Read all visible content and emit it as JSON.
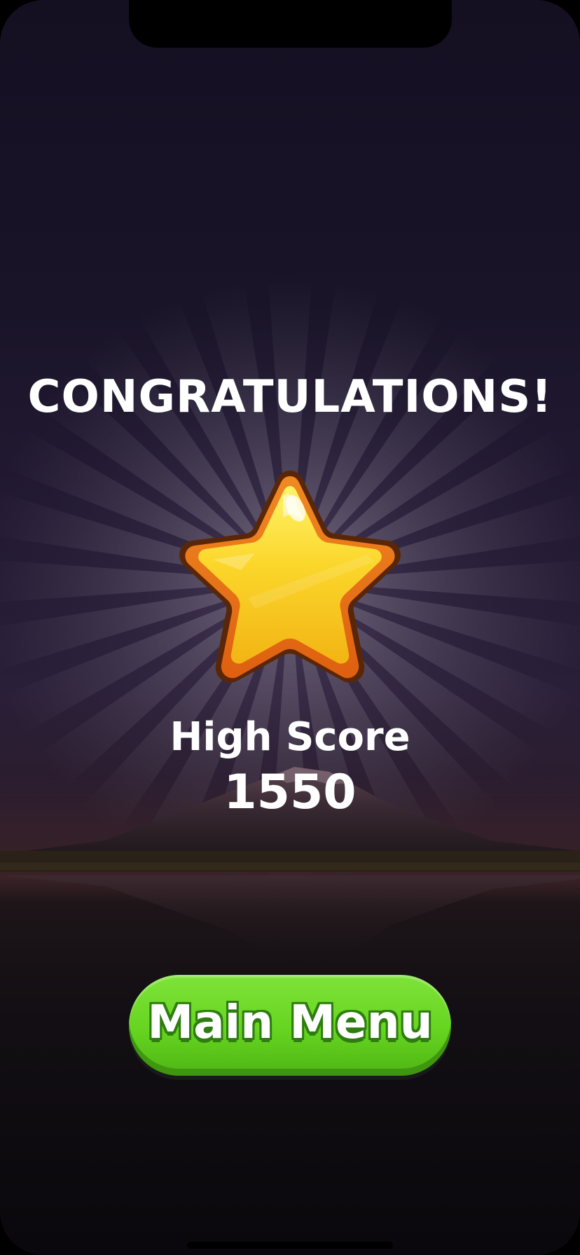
{
  "screen": {
    "title": "CONGRATULATIONS!",
    "score_label": "High Score",
    "score_value": "1550",
    "main_menu_label": "Main Menu"
  },
  "icons": {
    "star": "star-icon"
  },
  "colors": {
    "title_text": "#ffffff",
    "button_green": "#66d420",
    "button_text_outline": "#2e7d0f",
    "star_yellow": "#f7c61c",
    "star_outline": "#e6731a",
    "background_dark": "#150f22"
  }
}
